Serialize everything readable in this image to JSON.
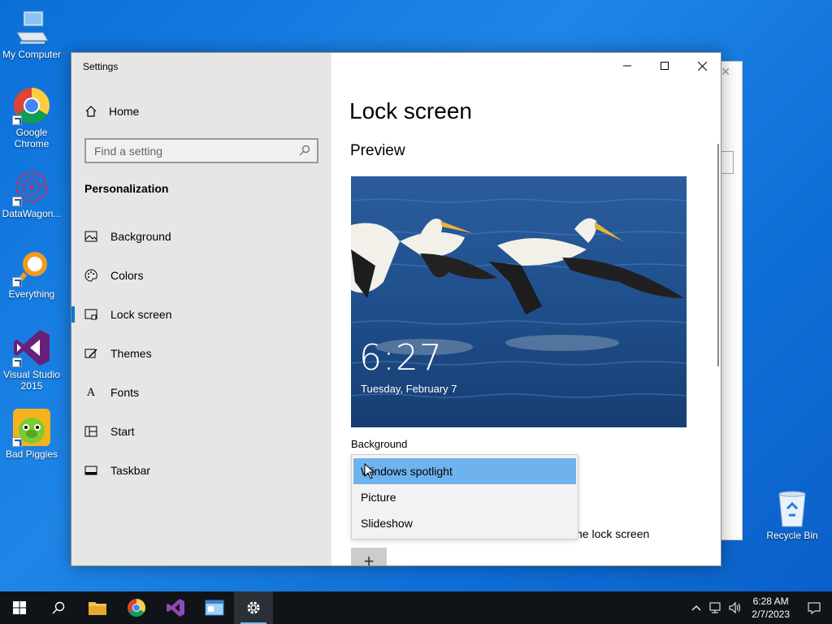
{
  "desktop": {
    "icons": [
      {
        "label": "My Computer",
        "icon": "computer-icon"
      },
      {
        "label": "Google Chrome",
        "icon": "chrome-icon"
      },
      {
        "label": "DataWagon...",
        "icon": "datawagon-icon"
      },
      {
        "label": "Everything",
        "icon": "everything-icon"
      },
      {
        "label": "Visual Studio 2015",
        "icon": "visual-studio-icon"
      },
      {
        "label": "Bad Piggies",
        "icon": "bad-piggies-icon"
      },
      {
        "label": "Recycle Bin",
        "icon": "recycle-bin-icon"
      }
    ]
  },
  "window": {
    "title": "Settings",
    "controls": {
      "minimize": "minimize-icon",
      "maximize": "maximize-icon",
      "close": "close-icon"
    }
  },
  "nav": {
    "home_label": "Home",
    "search_placeholder": "Find a setting",
    "section_title": "Personalization",
    "items": [
      {
        "label": "Background",
        "icon": "picture-icon"
      },
      {
        "label": "Colors",
        "icon": "palette-icon"
      },
      {
        "label": "Lock screen",
        "icon": "lock-screen-icon",
        "active": true
      },
      {
        "label": "Themes",
        "icon": "brush-icon"
      },
      {
        "label": "Fonts",
        "icon": "font-icon"
      },
      {
        "label": "Start",
        "icon": "start-icon"
      },
      {
        "label": "Taskbar",
        "icon": "taskbar-icon"
      }
    ]
  },
  "main": {
    "page_title": "Lock screen",
    "preview_title": "Preview",
    "preview_time": "6:27",
    "preview_date": "Tuesday, February 7",
    "background_label": "Background",
    "dropdown_options": [
      "Windows spotlight",
      "Picture",
      "Slideshow"
    ],
    "selected_option": "Windows spotlight",
    "partial_text": "ne lock screen",
    "add_button": "+"
  },
  "taskbar": {
    "time": "6:28 AM",
    "date": "2/7/2023",
    "accent": "#76b9ed"
  }
}
